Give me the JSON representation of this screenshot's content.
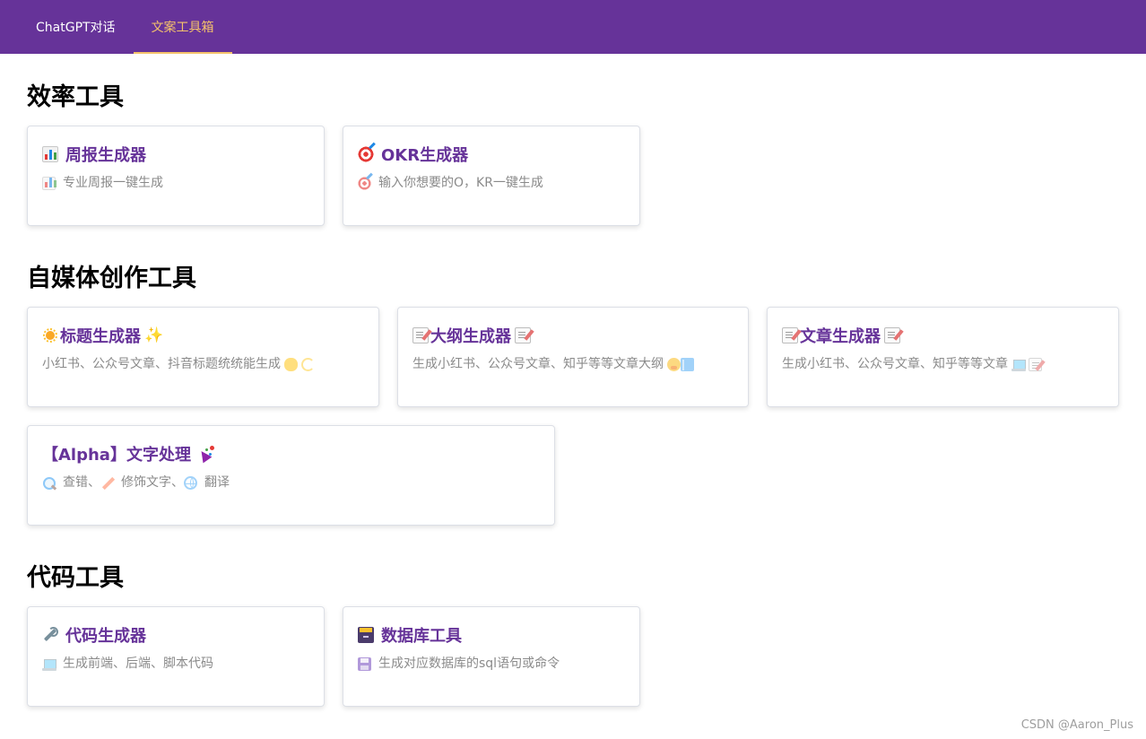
{
  "nav": {
    "tabs": [
      {
        "label": "ChatGPT对话",
        "active": false
      },
      {
        "label": "文案工具箱",
        "active": true
      }
    ]
  },
  "colors": {
    "nav_bg": "#663399",
    "active_tab": "#f5c26b",
    "card_title": "#663399",
    "card_desc": "#8a8a8a"
  },
  "sections": {
    "efficiency": {
      "title": "效率工具",
      "cards": [
        {
          "title": "周报生成器",
          "icon": "bar-chart-icon",
          "desc": "专业周报一键生成"
        },
        {
          "title": "OKR生成器",
          "icon": "direct-hit-icon",
          "desc": "输入你想要的O，KR一键生成"
        }
      ]
    },
    "media": {
      "title": "自媒体创作工具",
      "cards": [
        {
          "title": "标题生成器",
          "icon": "sun-icon",
          "desc": "小红书、公众号文章、抖音标题统统能生成"
        },
        {
          "title": "大纲生成器",
          "icon": "memo-icon",
          "desc": "生成小红书、公众号文章、知乎等等文章大纲"
        },
        {
          "title": "文章生成器",
          "icon": "memo-icon",
          "desc": "生成小红书、公众号文章、知乎等等文章"
        },
        {
          "title": "【Alpha】文字处理",
          "icon": "party-popper-icon",
          "desc_parts": [
            "查错、",
            "修饰文字、",
            "翻译"
          ]
        }
      ]
    },
    "code": {
      "title": "代码工具",
      "cards": [
        {
          "title": "代码生成器",
          "icon": "wrench-icon",
          "desc": "生成前端、后端、脚本代码"
        },
        {
          "title": "数据库工具",
          "icon": "file-cabinet-icon",
          "desc": "生成对应数据库的sql语句或命令"
        }
      ]
    }
  },
  "watermark": "CSDN @Aaron_Plus"
}
